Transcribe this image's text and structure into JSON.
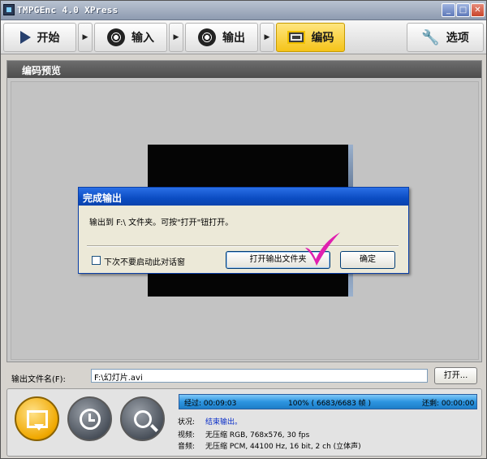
{
  "window": {
    "title": "TMPGEnc 4.0 XPress"
  },
  "toolbar": {
    "items": [
      {
        "label": "开始",
        "icon": "play-icon"
      },
      {
        "label": "输入",
        "icon": "film-reel-icon"
      },
      {
        "label": "输出",
        "icon": "film-reel-icon"
      },
      {
        "label": "编码",
        "icon": "film-strip-icon",
        "active": true
      },
      {
        "label": "选项",
        "icon": "wrench-icon"
      }
    ],
    "arrow": "▶"
  },
  "panel": {
    "title": "编码预览"
  },
  "dialog": {
    "title": "完成输出",
    "message": "输出到 F:\\ 文件夹。可按\"打开\"钮打开。",
    "checkbox_label": "下次不要启动此对话窗",
    "open_folder_button": "打开输出文件夹",
    "ok_button": "确定"
  },
  "output": {
    "label": "输出文件名(F):",
    "filename": "F:\\幻灯片.avi",
    "open_button": "打开..."
  },
  "progress": {
    "elapsed": "经过: 00:09:03",
    "percent_text": "100% ( 6683/6683 帧 )",
    "remaining": "还剩: 00:00:00",
    "fraction": 1.0
  },
  "status": {
    "state_label": "状况:",
    "state_value": "结束输出。",
    "video_label": "视频:",
    "video_value": "无压缩 RGB, 768x576, 30 fps",
    "audio_label": "音频:",
    "audio_value": "无压缩 PCM, 44100 Hz, 16 bit, 2 ch (立体声)"
  },
  "colors": {
    "accent_active": "#f5c419",
    "dialog_title": "#0b4cc2",
    "checkmark": "#e020b0",
    "status_value": "#0a2ec8"
  }
}
